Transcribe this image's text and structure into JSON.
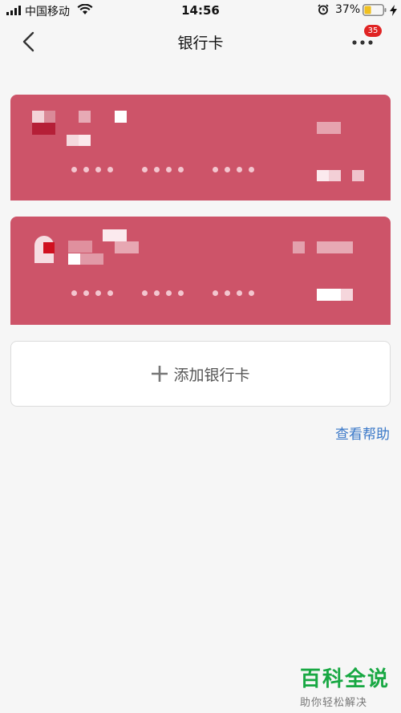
{
  "status_bar": {
    "carrier": "中国移动",
    "time": "14:56",
    "battery_percent": "37%",
    "battery_level": 0.37
  },
  "nav": {
    "title": "银行卡",
    "badge_count": "35"
  },
  "cards": [
    {
      "number_masked": "•••• •••• ••••",
      "color": "#cd5469"
    },
    {
      "number_masked": "•••• •••• ••••",
      "color": "#cd5469"
    }
  ],
  "add_card": {
    "label": "添加银行卡"
  },
  "help": {
    "label": "查看帮助"
  },
  "watermark": {
    "title": "百科全说",
    "subtitle": "助你轻松解决"
  },
  "colors": {
    "card": "#cd5469",
    "link": "#3a78c8",
    "badge": "#e02424",
    "battery_fill": "#f0c020",
    "watermark": "#18a843"
  }
}
